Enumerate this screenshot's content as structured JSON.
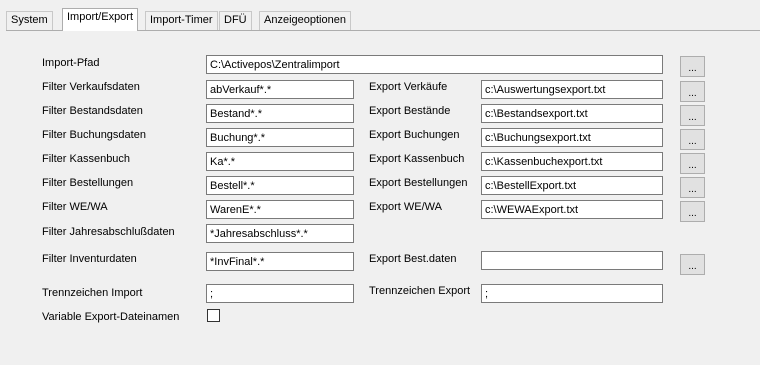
{
  "tabs": [
    {
      "label": "System"
    },
    {
      "label": "Import/Export"
    },
    {
      "label": "Import-Timer"
    },
    {
      "label": "DFÜ"
    },
    {
      "label": "Anzeigeoptionen"
    }
  ],
  "import_path": {
    "label": "Import-Pfad",
    "value": "C:\\Activepos\\Zentralimport",
    "button": "..."
  },
  "rows": [
    {
      "filter_label": "Filter Verkaufsdaten",
      "filter_value": "abVerkauf*.*",
      "export_label": "Export Verkäufe",
      "export_value": "c:\\Auswertungsexport.txt",
      "button": "..."
    },
    {
      "filter_label": "Filter Bestandsdaten",
      "filter_value": "Bestand*.*",
      "export_label": "Export Bestände",
      "export_value": "c:\\Bestandsexport.txt",
      "button": "..."
    },
    {
      "filter_label": "Filter Buchungsdaten",
      "filter_value": "Buchung*.*",
      "export_label": "Export Buchungen",
      "export_value": "c:\\Buchungsexport.txt",
      "button": "..."
    },
    {
      "filter_label": "Filter Kassenbuch",
      "filter_value": "Ka*.*",
      "export_label": "Export Kassenbuch",
      "export_value": "c:\\Kassenbuchexport.txt",
      "button": "..."
    },
    {
      "filter_label": "Filter Bestellungen",
      "filter_value": "Bestell*.*",
      "export_label": "Export Bestellungen",
      "export_value": "c:\\BestellExport.txt",
      "button": "..."
    },
    {
      "filter_label": "Filter WE/WA",
      "filter_value": "WarenE*.*",
      "export_label": "Export WE/WA",
      "export_value": "c:\\WEWAExport.txt",
      "button": "..."
    }
  ],
  "jahres": {
    "label": "Filter Jahresabschlußdaten",
    "value": "*Jahresabschluss*.*"
  },
  "inventur": {
    "filter_label": "Filter Inventurdaten",
    "filter_value": "*InvFinal*.*",
    "export_label": "Export Best.daten",
    "export_value": "",
    "button": "..."
  },
  "trenn_import": {
    "label": "Trennzeichen Import",
    "value": ";"
  },
  "trenn_export": {
    "label": "Trennzeichen Export",
    "value": ";"
  },
  "variable_export": {
    "label": "Variable Export-Dateinamen",
    "checked": false
  }
}
